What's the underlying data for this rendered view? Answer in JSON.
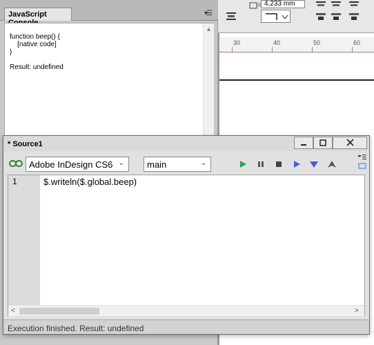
{
  "console": {
    "tab_label": "JavaScript Console",
    "output": "function beep() {\n    [native code]\n}\n\nResult: undefined"
  },
  "background": {
    "measurement": "4,233 mm",
    "ruler_labels": [
      "30",
      "40",
      "50",
      "60"
    ]
  },
  "source_window": {
    "title": "* Source1",
    "target_app": "Adobe InDesign CS6",
    "engine": "main",
    "line_number": "1",
    "code": "$.writeln($.global.beep)",
    "status": "Execution finished. Result: undefined"
  },
  "icons": {
    "link": "link-icon",
    "run": "run-icon",
    "pause": "pause-icon",
    "stop": "stop-icon",
    "step_over": "step-over-icon",
    "step_into": "step-into-icon",
    "step_out": "step-out-icon"
  },
  "colors": {
    "run_green": "#2aa24a",
    "step_blue": "#4a5bd6",
    "link_green": "#2d8a2d"
  }
}
